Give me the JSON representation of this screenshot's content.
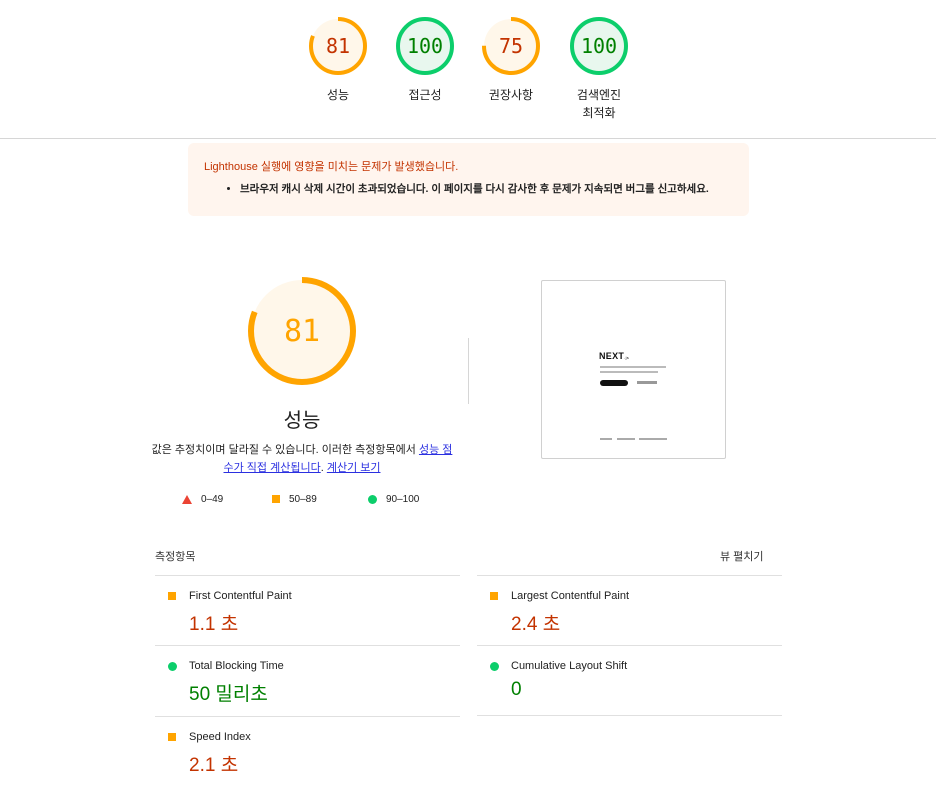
{
  "colors": {
    "average": "#ffa400",
    "average_text": "#c33300",
    "pass": "#0cce6b",
    "pass_text": "#008000",
    "fail": "#eb4334"
  },
  "gauges": [
    {
      "score": "81",
      "label_lines": [
        "성능"
      ],
      "status": "average"
    },
    {
      "score": "100",
      "label_lines": [
        "접근성"
      ],
      "status": "pass"
    },
    {
      "score": "75",
      "label_lines": [
        "권장사항"
      ],
      "status": "average"
    },
    {
      "score": "100",
      "label_lines": [
        "검색엔진",
        "최적화"
      ],
      "status": "pass"
    }
  ],
  "warning": {
    "title": "Lighthouse 실행에 영향을 미치는 문제가 발생했습니다.",
    "item": "브라우저 캐시 삭제 시간이 초과되었습니다. 이 페이지를 다시 감사한 후 문제가 지속되면 버그를 신고하세요."
  },
  "performance": {
    "score": "81",
    "title": "성능",
    "desc_prefix": "값은 추정치이며 달라질 수 있습니다. 이러한 측정항목에서 ",
    "desc_link1": "성능 점수가 직접 계산됩니다",
    "desc_middle": ". ",
    "desc_link2": "계산기 보기"
  },
  "legend": [
    {
      "shape": "triangle-icon",
      "range": "0–49"
    },
    {
      "shape": "square-icon",
      "range": "50–89"
    },
    {
      "shape": "circle-icon",
      "range": "90–100"
    }
  ],
  "screenshot": {
    "logo": "NEXT",
    "logo_suffix": ".js"
  },
  "metrics_section": {
    "heading": "측정항목",
    "expand_label": "뷰 펼치기"
  },
  "metrics": [
    {
      "title": "First Contentful Paint",
      "value": "1.1 초",
      "status": "average"
    },
    {
      "title": "Largest Contentful Paint",
      "value": "2.4 초",
      "status": "average"
    },
    {
      "title": "Total Blocking Time",
      "value": "50 밀리초",
      "status": "pass"
    },
    {
      "title": "Cumulative Layout Shift",
      "value": "0",
      "status": "pass"
    },
    {
      "title": "Speed Index",
      "value": "2.1 초",
      "status": "average"
    }
  ]
}
